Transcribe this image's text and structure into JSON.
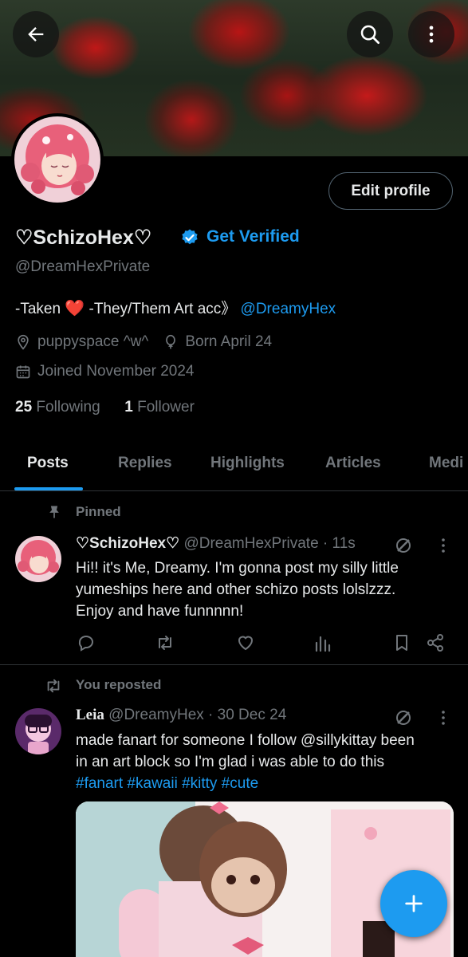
{
  "profile": {
    "name": "♡SchizoHex♡",
    "get_verified": "Get Verified",
    "handle": "@DreamHexPrivate",
    "bio_prefix": "-Taken ",
    "bio_heart": "❤️",
    "bio_middle": " -They/Them Art acc》 ",
    "bio_link": "@DreamyHex",
    "location": "puppyspace ^w^",
    "birthday": "Born April 24",
    "joined": "Joined November 2024",
    "following_count": "25",
    "following_label": "Following",
    "followers_count": "1",
    "followers_label": "Follower",
    "edit_profile": "Edit profile"
  },
  "tabs": [
    "Posts",
    "Replies",
    "Highlights",
    "Articles",
    "Media"
  ],
  "tab_fragment": "Medi",
  "pinned_post": {
    "label": "Pinned",
    "name": "♡SchizoHex♡",
    "handle_time": "@DreamHexPrivate · 11s",
    "lines": [
      "Hi!! it's Me, Dreamy. I'm gonna post my silly little",
      "yumeships  here and other schizo posts lolslzzz.",
      "Enjoy and have funnnnn!"
    ]
  },
  "repost": {
    "label": "You reposted",
    "name": "Leia",
    "handle_time": "@DreamyHex · 30 Dec 24",
    "lines": [
      "made fanart for someone I follow @sillykittay been",
      "in an art block so I'm glad i was able to do this"
    ],
    "hashtags": "#fanart #kawaii #kitty #cute"
  },
  "colors": {
    "accent": "#1d9bf0",
    "muted": "#71767b",
    "text": "#e7e9ea",
    "heart": "#f91880",
    "divider": "#2f3336"
  },
  "icons": {
    "back": "arrow-left-icon",
    "search": "search-icon",
    "more": "more-vertical-icon",
    "verified": "verified-badge-icon",
    "location": "location-pin-icon",
    "birthday": "balloon-icon",
    "calendar": "calendar-icon",
    "pin": "pin-icon",
    "repost": "repost-icon",
    "reply": "reply-icon",
    "like": "heart-outline-icon",
    "views": "views-icon",
    "bookmark": "bookmark-icon",
    "share": "share-icon",
    "grok": "grok-icon",
    "compose": "plus-icon"
  }
}
